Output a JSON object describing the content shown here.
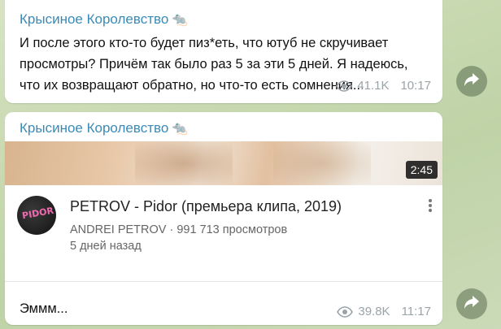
{
  "messages": [
    {
      "sender": "Крысиное Королевство",
      "sender_emoji": "🐀",
      "text": "И после этого кто-то будет пиз*еть, что ютуб не скручивает просмотры? Причём так было раз 5 за эти 5 дней. Я надеюсь, что их возвращают обратно, но что-то есть сомнения...",
      "views": "41.1K",
      "time": "10:17"
    },
    {
      "sender": "Крысиное Королевство",
      "sender_emoji": "🐀",
      "video": {
        "duration": "2:45",
        "avatar_text": "PIDOR",
        "title": "PETROV - Pidor (премьера клипа, 2019)",
        "channel_line": "ANDREI PETROV · 991 713 просмотров",
        "age": "5 дней назад"
      },
      "text": "Эммм...",
      "views": "39.8K",
      "time": "11:17"
    }
  ],
  "icons": {
    "views": "eye-icon",
    "share": "share-arrow-icon",
    "menu": "more-vert-icon"
  },
  "colors": {
    "sender": "#3a8ab8",
    "meta": "#9aa3a8",
    "background": "#c8d9b0"
  }
}
